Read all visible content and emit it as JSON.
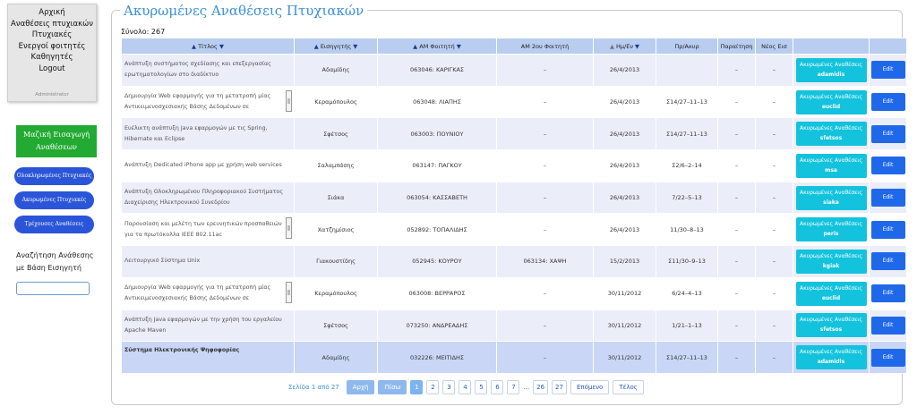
{
  "nav": {
    "items": [
      "Αρχική",
      "Αναθέσεις πτυχιακών",
      "Πτυχιακές",
      "Ενεργοί φοιτητές",
      "Καθηγητές",
      "Logout"
    ],
    "role": "Administrator"
  },
  "sidebar": {
    "bulk_import": "Μαζική Εισαγωγή Αναθέσεων",
    "btn_completed": "Ολοκληρωμένες Πτυχιακές",
    "btn_cancelled": "Ακυρωμένες Πτυχιακές",
    "btn_current": "Τρέχουσες Αναθέσεις",
    "search_label": "Αναζήτηση Ανάθεσης με Βάση Εισηγητή",
    "search_value": ""
  },
  "page": {
    "title": "Ακυρωμένες Αναθέσεις Πτυχιακών",
    "total": "Σύνολο: 267"
  },
  "table": {
    "headers": {
      "title": "Τίτλος",
      "supervisor": "Εισηγητής",
      "am": "ΑΜ Φοιτητή",
      "am2": "ΑΜ 2ου Φοιτητή",
      "date": "Ημ/Εν",
      "protocol": "Πρ/Ακυρ",
      "resign": "Παραίτηση",
      "new_sup": "Νέος Εισ"
    },
    "rows": [
      {
        "title": "Ανάπτυξη συστήματος σχεδίασης και επεξεργασίας ερωτηματολογίων στο διαδίκτυο",
        "sup": "Αδαμίδης",
        "am": "063046: ΚΑΡΙΓΚΑΣ",
        "am2": "–",
        "date": "26/4/2013",
        "prot": "",
        "res": "–",
        "newsup": "–",
        "btn": "adamidis"
      },
      {
        "title": "Δημιουργία Web εφαρμογής για τη μετατροπή μίας Αντικειμενοσχεσιακής Βάσης Δεδομένων σε",
        "sup": "Κεραμόπουλος",
        "am": "063048: ΛΙΑΠΗΣ",
        "am2": "–",
        "date": "26/4/2013",
        "prot": "Σ14/27–11–13",
        "res": "–",
        "newsup": "–",
        "btn": "euclid",
        "scroll": true
      },
      {
        "title": "Ευέλικτη ανάπτυξη Java εφαρμογών με τις Spring, Hibernate και Eclipse",
        "sup": "Σφέτσος",
        "am": "063003: ΠΟΥΝΙΟΥ",
        "am2": "–",
        "date": "26/4/2013",
        "prot": "Σ14/27–11–13",
        "res": "–",
        "newsup": "–",
        "btn": "sfetsos"
      },
      {
        "title": "Ανάπτυξη Dedicated iPhone app με χρήση web services",
        "sup": "Σαλαμπάσης",
        "am": "063147: ΠΑΓΚΟΥ",
        "am2": "–",
        "date": "26/4/2013",
        "prot": "Σ2/6–2–14",
        "res": "–",
        "newsup": "–",
        "btn": "msa"
      },
      {
        "title": "Ανάπτυξη Ολοκληρωμένου Πληροφοριακού Συστήματος Διαχείρισης Ηλεκτρονικού Συνεδρίου",
        "sup": "Σιάκα",
        "am": "063054: ΚΑΣΣΑΒΕΤΗ",
        "am2": "–",
        "date": "26/4/2013",
        "prot": "7/22–5–13",
        "res": "–",
        "newsup": "–",
        "btn": "siaka"
      },
      {
        "title": "Παρουσίαση και μελέτη των ερευνητικών προσπαθειών για τα πρωτόκολλα IEEE 802.11ac",
        "sup": "Χατζημίσιος",
        "am": "052892: ΤΟΠΑΛΙΔΗΣ",
        "am2": "–",
        "date": "26/4/2013",
        "prot": "11/30–8–13",
        "res": "–",
        "newsup": "–",
        "btn": "peris",
        "scroll": true
      },
      {
        "title": "Λειτουργικό Σύστημα Unix",
        "sup": "Γιακουστίδης",
        "am": "052945: ΚΟΥΡΟΥ",
        "am2": "063134: ΧΑΨΗ",
        "date": "15/2/2013",
        "prot": "Σ11/30–9–13",
        "res": "–",
        "newsup": "–",
        "btn": "kgiak"
      },
      {
        "title": "Δημιουργία Web εφαρμογής για τη μετατροπή μίας Αντικειμενοσχεσιακής Βάσης Δεδομένων σε",
        "sup": "Κεραμόπουλος",
        "am": "063008: ΒΕΡΡΑΡΟΣ",
        "am2": "–",
        "date": "30/11/2012",
        "prot": "6/24–4–13",
        "res": "–",
        "newsup": "–",
        "btn": "euclid",
        "scroll": true
      },
      {
        "title": "Ανάπτυξη Java εφαρμογών με την χρήση του εργαλείου Apache Maven",
        "sup": "Σφέτσος",
        "am": "073250: ΑΝΔΡΕΑΔΗΣ",
        "am2": "–",
        "date": "30/11/2012",
        "prot": "1/21–1–13",
        "res": "–",
        "newsup": "–",
        "btn": "sfetsos"
      },
      {
        "title": "Σύστημα Ηλεκτρονικής Ψηφοφορίας",
        "sup": "Αδαμίδης",
        "am": "032226: ΜΕΙΤΙΔΗΣ",
        "am2": "–",
        "date": "30/11/2012",
        "prot": "Σ14/27–11–13",
        "res": "–",
        "newsup": "–",
        "btn": "adamidis"
      }
    ],
    "cancelled_btn_label": "Ακυρωμένες Αναθέσεις",
    "edit_label": "Edit"
  },
  "pagination": {
    "info": "Σελίδα 1 από 27",
    "first": "Αρχή",
    "prev": "Πίσω",
    "pages": [
      "1",
      "2",
      "3",
      "4",
      "5",
      "6",
      "7"
    ],
    "dots": "...",
    "tail": [
      "26",
      "27"
    ],
    "next": "Επόμενο",
    "last": "Τέλος"
  }
}
